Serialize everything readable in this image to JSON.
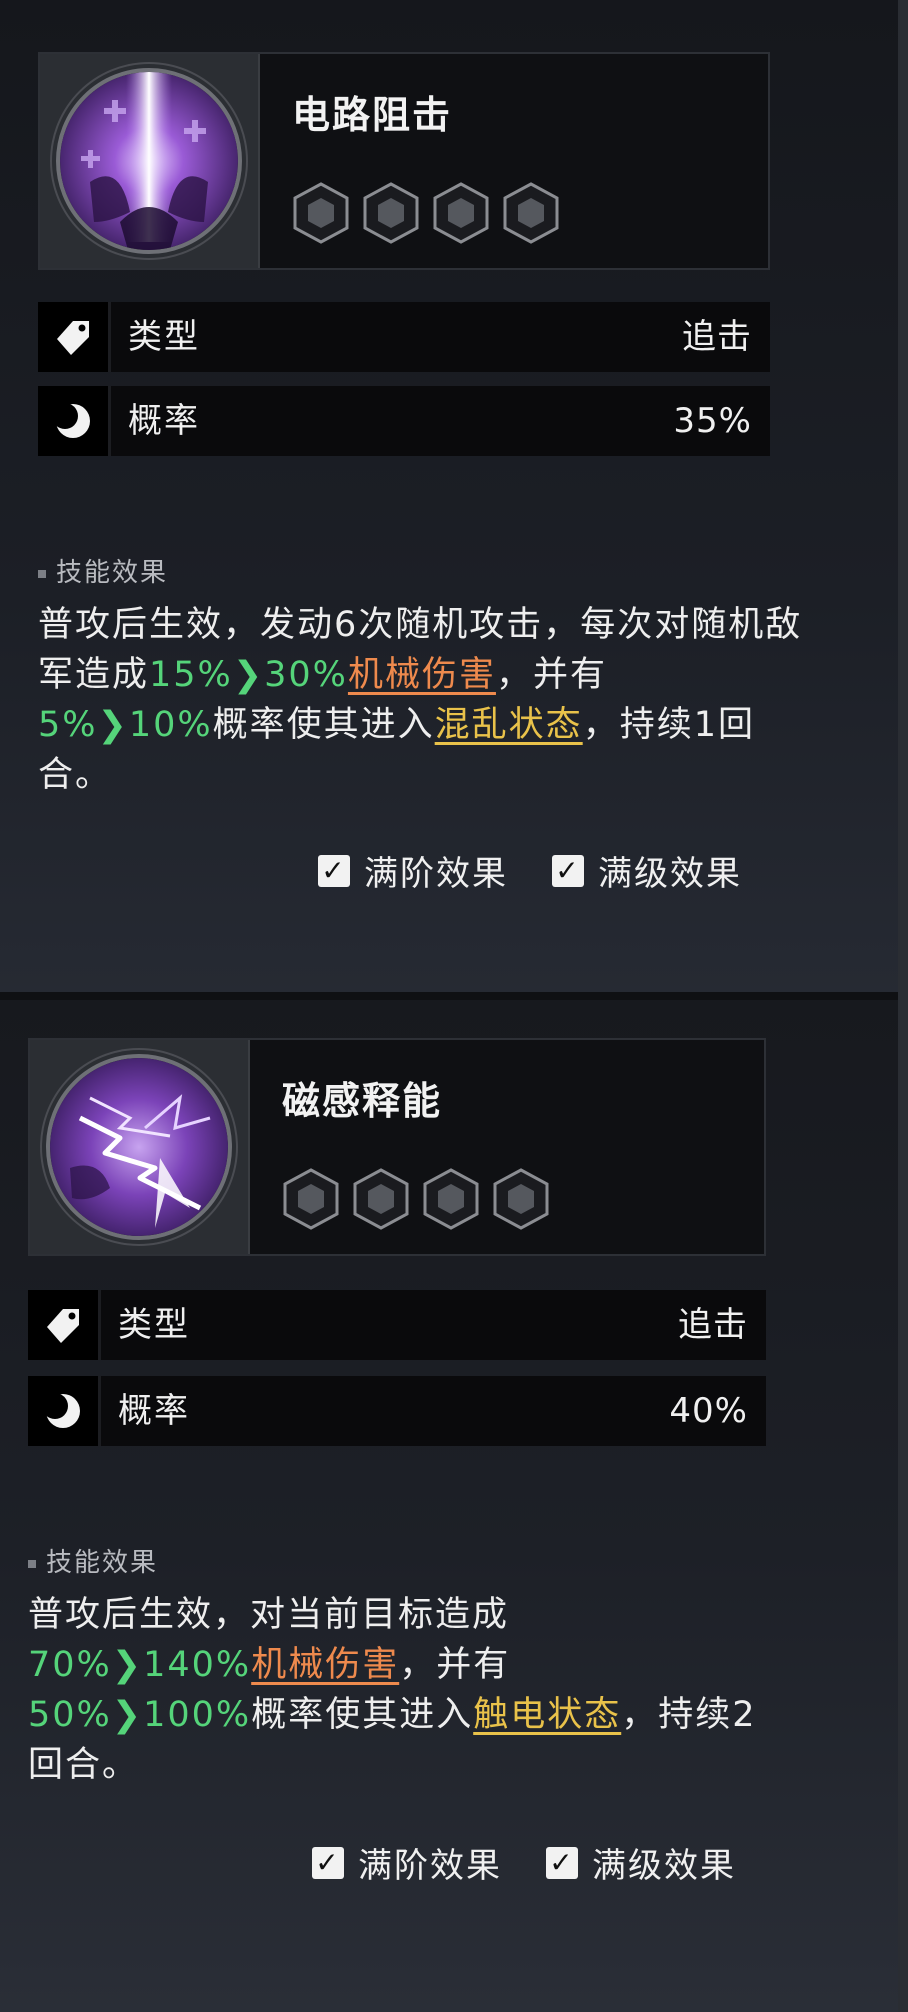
{
  "skills": [
    {
      "name": "电路阻击",
      "rank_count": 4,
      "stats": [
        {
          "icon": "tag-icon",
          "label": "类型",
          "value": "追击"
        },
        {
          "icon": "moon-icon",
          "label": "概率",
          "value": "35%"
        }
      ],
      "section_title": "技能效果",
      "description": {
        "t1": "普攻后生效，发动6次随机攻击，每次对随机敌军造成",
        "v1a": "15%",
        "arrow1": "❯",
        "v1b": "30%",
        "dmg": "机械伤害",
        "t2": "，并有",
        "v2a": "5%",
        "arrow2": "❯",
        "v2b": "10%",
        "t3": "概率使其进入",
        "state": "混乱状态",
        "t4": "，持续1回合。"
      },
      "checks": [
        {
          "label": "满阶效果",
          "checked": "✓"
        },
        {
          "label": "满级效果",
          "checked": "✓"
        }
      ]
    },
    {
      "name": "磁感释能",
      "rank_count": 4,
      "stats": [
        {
          "icon": "tag-icon",
          "label": "类型",
          "value": "追击"
        },
        {
          "icon": "moon-icon",
          "label": "概率",
          "value": "40%"
        }
      ],
      "section_title": "技能效果",
      "description": {
        "t1": "普攻后生效，对当前目标造成",
        "v1a": "70%",
        "arrow1": "❯",
        "v1b": "140%",
        "dmg": "机械伤害",
        "t2": "，并有",
        "v2a": "50%",
        "arrow2": "❯",
        "v2b": "100%",
        "t3": "概率使其进入",
        "state": "触电状态",
        "t4": "，持续2回合。"
      },
      "checks": [
        {
          "label": "满阶效果",
          "checked": "✓"
        },
        {
          "label": "满级效果",
          "checked": "✓"
        }
      ]
    }
  ],
  "colors": {
    "green": "#55d47a",
    "orange": "#ee8a4d",
    "yellow": "#e9c24a",
    "purple": "#8a4fc7"
  }
}
